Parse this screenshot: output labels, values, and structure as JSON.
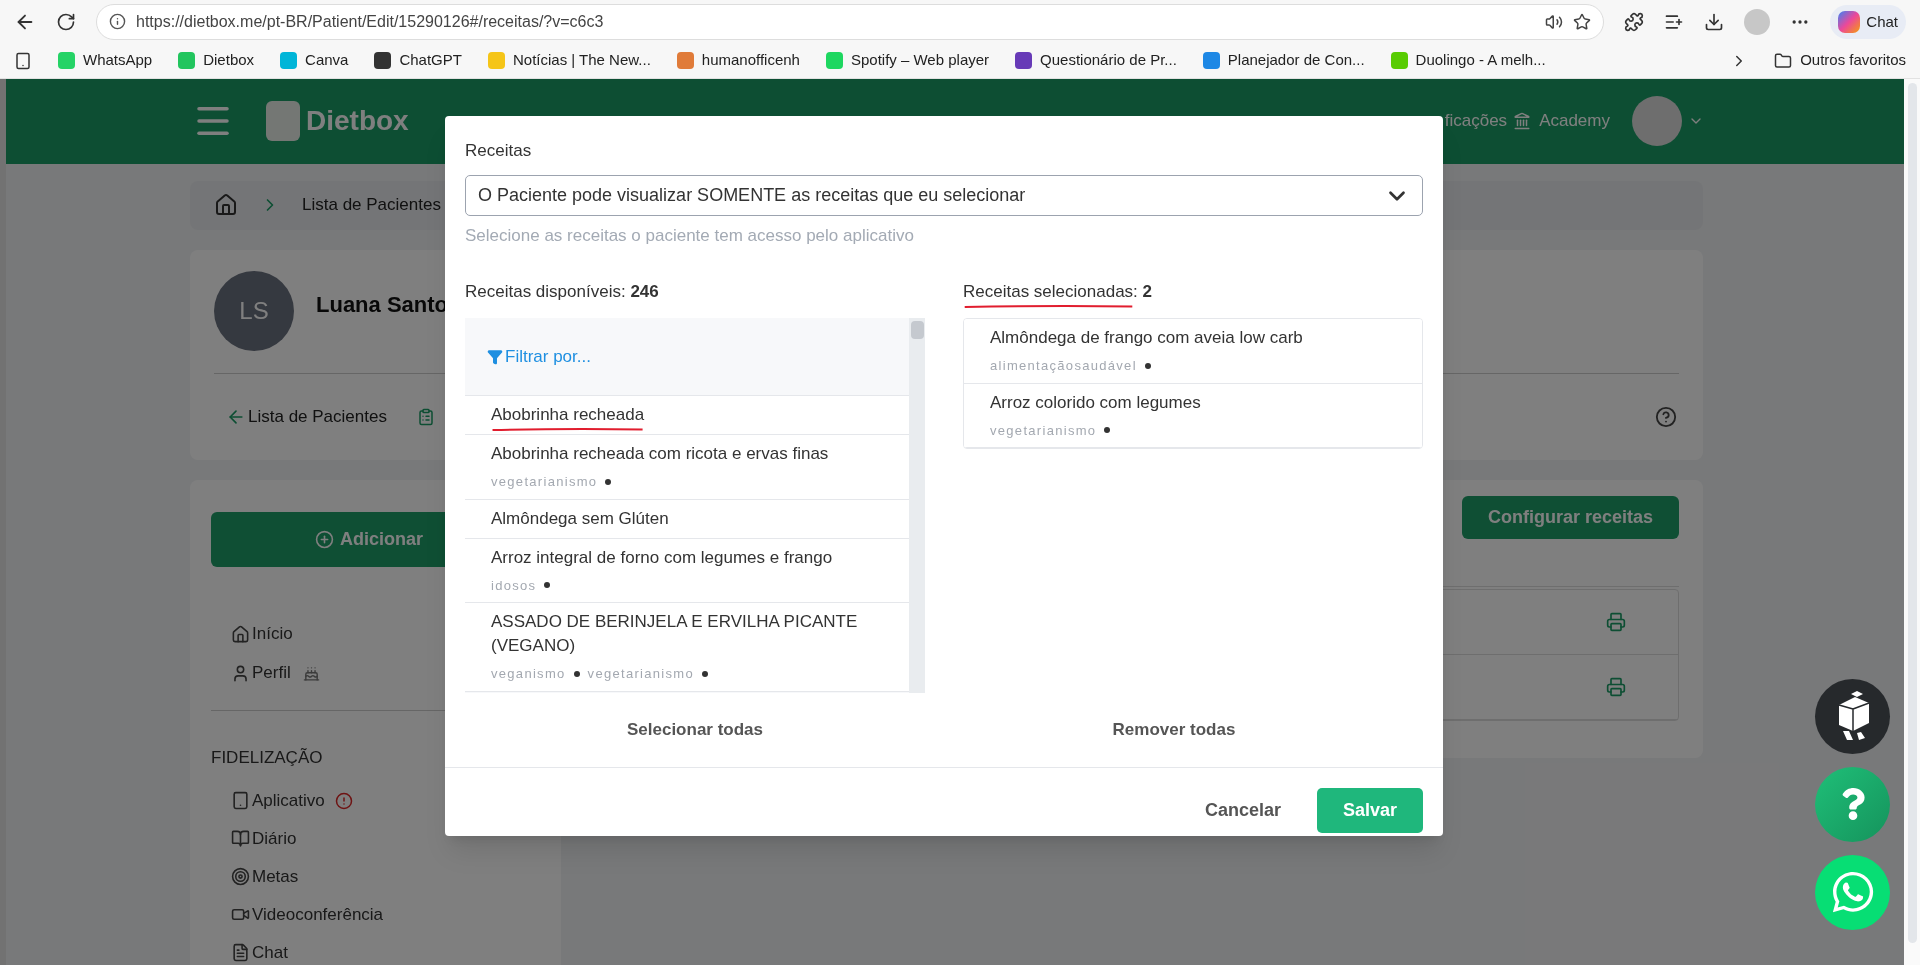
{
  "browser": {
    "url": "https://dietbox.me/pt-BR/Patient/Edit/15290126#/receitas/?v=c6c3",
    "copilot": "Chat",
    "bookmarks": [
      {
        "label": "WhatsApp",
        "color": "#25d366"
      },
      {
        "label": "Dietbox",
        "color": "#22c55e"
      },
      {
        "label": "Canva",
        "color": "#00b5d8"
      },
      {
        "label": "ChatGPT",
        "color": "#333333"
      },
      {
        "label": "Notícias | The New...",
        "color": "#f5c518"
      },
      {
        "label": "humanofficenh",
        "color": "#e07b39"
      },
      {
        "label": "Spotify – Web player",
        "color": "#1ed760"
      },
      {
        "label": "Questionário de Pr...",
        "color": "#673ab7"
      },
      {
        "label": "Planejador de Con...",
        "color": "#1e88e5"
      },
      {
        "label": "Duolingo - A melh...",
        "color": "#58cc02"
      }
    ],
    "other_bookmarks": "Outros favoritos"
  },
  "header": {
    "logo": "Dietbox",
    "notifications_partial": "ficações",
    "academy": "Academy"
  },
  "breadcrumb": "Lista de Pacientes",
  "patient": {
    "initials": "LS",
    "name": "Luana Santo",
    "back_link": "Lista de Pacientes"
  },
  "sidebar": {
    "add_button": "Adicionar",
    "items": [
      {
        "label": "Início",
        "kind": "home",
        "birthday": false
      },
      {
        "label": "Perfil",
        "kind": "user",
        "birthday": true
      }
    ],
    "section": "FIDELIZAÇÃO",
    "section_items": [
      {
        "label": "Aplicativo",
        "kind": "phone",
        "alert": true
      },
      {
        "label": "Diário",
        "kind": "book",
        "alert": false
      },
      {
        "label": "Metas",
        "kind": "target",
        "alert": false
      },
      {
        "label": "Videoconferência",
        "kind": "video",
        "alert": false
      },
      {
        "label": "Chat",
        "kind": "chat",
        "alert": false
      }
    ]
  },
  "main": {
    "configure_button": "Configurar receitas",
    "rows": [
      {
        "kind": "print"
      },
      {
        "kind": "print"
      }
    ]
  },
  "modal": {
    "label": "Receitas",
    "select_value": "O Paciente pode visualizar SOMENTE as receitas que eu selecionar",
    "hint": "Selecione as receitas o paciente tem acesso pelo aplicativo",
    "available": {
      "heading": "Receitas disponíveis: **246**",
      "underlined": false,
      "filter": "Filtrar por...",
      "items": [
        {
          "title": "Abobrinha recheada",
          "underlined": true
        },
        {
          "title": "Abobrinha recheada com ricota e ervas finas",
          "tags": [
            "vegetarianismo"
          ],
          "underlined": false
        },
        {
          "title": "Almôndega sem Glúten",
          "underlined": false
        },
        {
          "title": "Arroz integral de forno com legumes e frango",
          "tags": [
            "idosos"
          ],
          "underlined": false
        },
        {
          "title": "ASSADO DE BERINJELA E ERVILHA PICANTE (VEGANO)",
          "tags": [
            "veganismo",
            "vegetarianismo"
          ],
          "underlined": false
        }
      ]
    },
    "selected": {
      "heading": "Receitas selecionadas: **2**",
      "underlined": true,
      "items": [
        {
          "title": "Almôndega de frango com aveia low carb",
          "tags": [
            "alimentaçãosaudável"
          ],
          "underlined": false
        },
        {
          "title": "Arroz colorido com legumes",
          "tags": [
            "vegetarianismo"
          ],
          "underlined": false
        }
      ]
    },
    "select_all": "Selecionar todas",
    "remove_all": "Remover todas",
    "cancel": "Cancelar",
    "save": "Salvar"
  }
}
